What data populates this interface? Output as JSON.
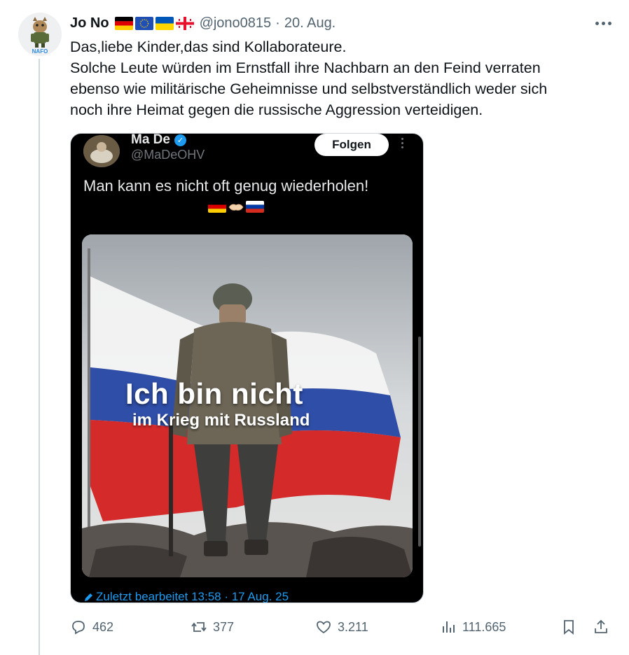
{
  "tweet": {
    "author": {
      "display_name": "Jo No",
      "handle": "@jono0815",
      "date": "20. Aug.",
      "separator": "·",
      "flags": [
        "germany-flag",
        "eu-flag",
        "ukraine-flag",
        "georgia-flag"
      ],
      "avatar_badge": "NAFO"
    },
    "text_lines": [
      "Das,liebe Kinder,das sind Kollaborateure.",
      "Solche Leute würden im Ernstfall ihre Nachbarn an den Feind verraten",
      "ebenso wie militärische Geheimnisse und selbstverständlich weder sich",
      "noch ihre Heimat gegen die russische Aggression verteidigen."
    ]
  },
  "quoted_screenshot": {
    "display_name": "Ma De",
    "handle": "@MaDeOHV",
    "follow_label": "Folgen",
    "text": "Man kann es nicht oft genug wiederholen!",
    "emoji": [
      "germany-flag",
      "handshake-icon",
      "russia-flag"
    ],
    "image_caption_line1": "Ich bin nicht",
    "image_caption_line2": "im Krieg mit Russland",
    "edited_label": "Zuletzt bearbeitet 13:58 · 17 Aug. 25"
  },
  "actions": {
    "replies": "462",
    "reposts": "377",
    "likes": "3.211",
    "views": "111.665"
  },
  "colors": {
    "text": "#0f1419",
    "secondary": "#536471",
    "accent": "#1d9bf0",
    "border": "#cfd9de"
  }
}
